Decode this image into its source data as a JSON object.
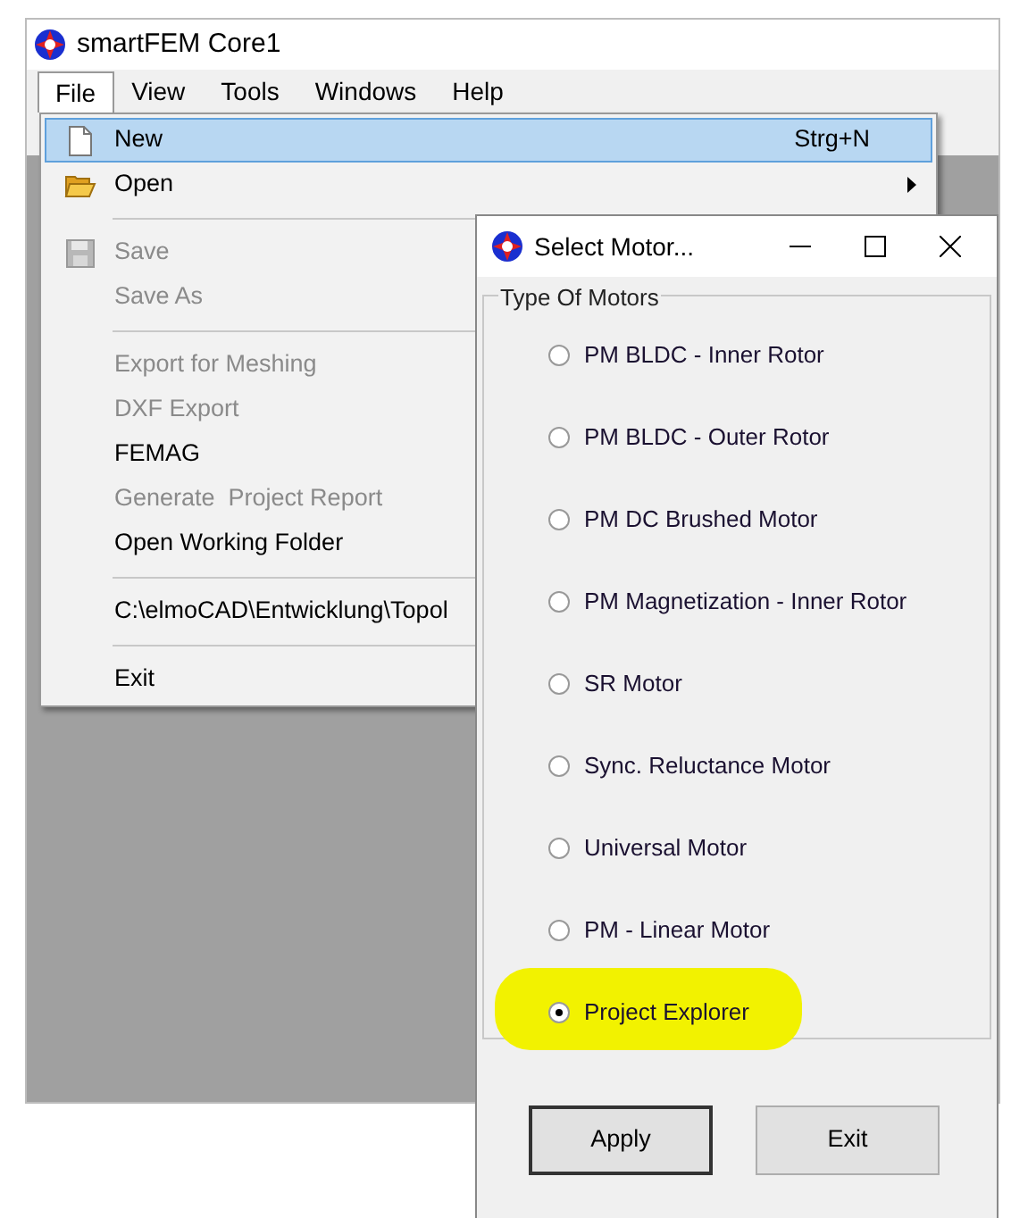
{
  "window": {
    "title": "smartFEM Core1"
  },
  "menubar": [
    {
      "label": "File",
      "selected": true
    },
    {
      "label": "View",
      "selected": false
    },
    {
      "label": "Tools",
      "selected": false
    },
    {
      "label": "Windows",
      "selected": false
    },
    {
      "label": "Help",
      "selected": false
    }
  ],
  "file_menu": [
    {
      "kind": "page",
      "label": "New",
      "shortcut": "Strg+N",
      "selected": true,
      "disabled": false
    },
    {
      "kind": "folder",
      "label": "Open",
      "submenu": true,
      "selected": false,
      "disabled": false
    },
    {
      "kind": "separator"
    },
    {
      "kind": "disk",
      "label": "Save",
      "selected": false,
      "disabled": true
    },
    {
      "kind": "item",
      "label": "Save As",
      "selected": false,
      "disabled": true
    },
    {
      "kind": "separator"
    },
    {
      "kind": "item",
      "label": "Export for Meshing",
      "selected": false,
      "disabled": true
    },
    {
      "kind": "item",
      "label": "DXF Export",
      "selected": false,
      "disabled": true
    },
    {
      "kind": "item",
      "label": "FEMAG",
      "selected": false,
      "disabled": false
    },
    {
      "kind": "item",
      "label": "Generate  Project Report",
      "selected": false,
      "disabled": true
    },
    {
      "kind": "item",
      "label": "Open Working Folder",
      "selected": false,
      "disabled": false
    },
    {
      "kind": "separator"
    },
    {
      "kind": "item",
      "label": "C:\\elmoCAD\\Entwicklung\\Topol",
      "selected": false,
      "disabled": false
    },
    {
      "kind": "separator"
    },
    {
      "kind": "item",
      "label": "Exit",
      "selected": false,
      "disabled": false
    }
  ],
  "dialog": {
    "title": "Select Motor...",
    "group_label": "Type Of Motors",
    "options": [
      {
        "label": "PM BLDC - Inner Rotor",
        "selected": false,
        "highlighted": false
      },
      {
        "label": "PM BLDC - Outer Rotor",
        "selected": false,
        "highlighted": false
      },
      {
        "label": "PM DC Brushed Motor",
        "selected": false,
        "highlighted": false
      },
      {
        "label": "PM Magnetization - Inner Rotor",
        "selected": false,
        "highlighted": false
      },
      {
        "label": "SR Motor",
        "selected": false,
        "highlighted": false
      },
      {
        "label": "Sync. Reluctance Motor",
        "selected": false,
        "highlighted": false
      },
      {
        "label": "Universal Motor",
        "selected": false,
        "highlighted": false
      },
      {
        "label": "PM - Linear Motor",
        "selected": false,
        "highlighted": false
      },
      {
        "label": "Project Explorer",
        "selected": true,
        "highlighted": true
      }
    ],
    "buttons": [
      {
        "label": "Apply",
        "default": true
      },
      {
        "label": "Exit",
        "default": false
      }
    ]
  }
}
